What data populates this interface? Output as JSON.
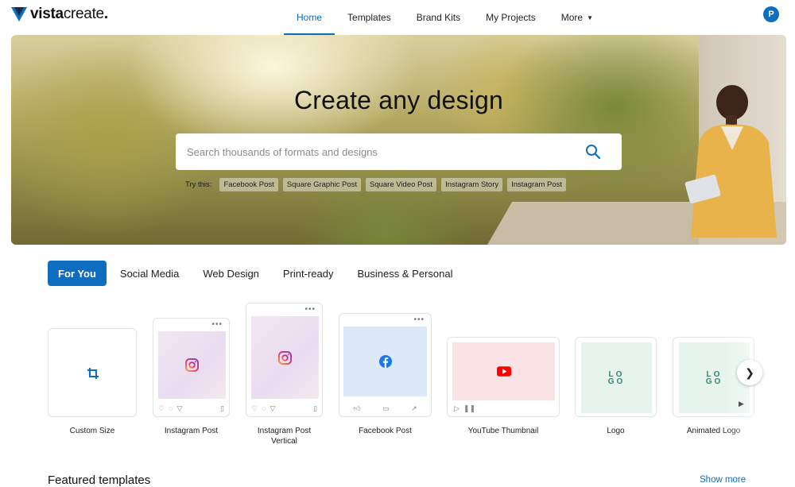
{
  "brand": {
    "name_bold": "vista",
    "name_light": "create",
    "suffix": ".",
    "accent": "#0d6ec0"
  },
  "nav": {
    "items": [
      {
        "label": "Home",
        "active": true
      },
      {
        "label": "Templates"
      },
      {
        "label": "Brand Kits"
      },
      {
        "label": "My Projects"
      },
      {
        "label": "More"
      }
    ]
  },
  "user": {
    "avatar_initial": "P"
  },
  "hero": {
    "title": "Create any design",
    "search_placeholder": "Search thousands of formats and designs",
    "try_label": "Try this:",
    "suggestions": [
      "Facebook Post",
      "Square Graphic Post",
      "Square Video Post",
      "Instagram Story",
      "Instagram Post"
    ]
  },
  "categories": {
    "tabs": [
      "For You",
      "Social Media",
      "Web Design",
      "Print-ready",
      "Business & Personal"
    ],
    "active": "For You"
  },
  "formats": [
    {
      "label": "Custom Size",
      "icon": "crop-icon"
    },
    {
      "label": "Instagram Post",
      "icon": "instagram-icon"
    },
    {
      "label_line1": "Instagram Post",
      "label_line2": "Vertical",
      "icon": "instagram-icon"
    },
    {
      "label": "Facebook Post",
      "icon": "facebook-icon"
    },
    {
      "label": "YouTube Thumbnail",
      "icon": "youtube-icon"
    },
    {
      "label": "Logo",
      "logo_text": "LOGO"
    },
    {
      "label": "Animated Logo",
      "logo_text": "LOGO"
    }
  ],
  "featured": {
    "title": "Featured templates",
    "show_more": "Show more"
  }
}
